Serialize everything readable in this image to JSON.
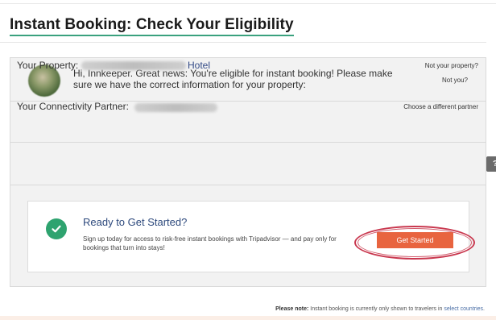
{
  "page": {
    "title": "Instant Booking: Check Your Eligibility"
  },
  "greeting": {
    "message": "Hi, Innkeeper. Great news: You're eligible for instant booking! Please make sure we have the correct information for your property:",
    "not_you_link": "Not you?"
  },
  "property": {
    "label": "Your Property:",
    "name_suffix": "Hotel",
    "not_your_property_link": "Not your property?"
  },
  "partner": {
    "label": "Your Connectivity Partner:",
    "choose_link": "Choose a different partner",
    "help_label": "?"
  },
  "ready_card": {
    "title": "Ready to Get Started?",
    "description": "Sign up today for access to risk-free instant bookings with Tripadvisor — and pay only for bookings that turn into stays!",
    "cta_label": "Get Started"
  },
  "footnote": {
    "prefix": "Please note:",
    "text": " Instant booking is currently only shown to travelers in ",
    "link": "select countries",
    "suffix": "."
  },
  "colors": {
    "accent_green": "#2ea36f",
    "cta_orange": "#e8643f",
    "highlight_red": "#c9384f",
    "title_blue": "#2e4a7d"
  },
  "icons": {
    "check": "check-circle-icon",
    "help": "question-icon"
  }
}
